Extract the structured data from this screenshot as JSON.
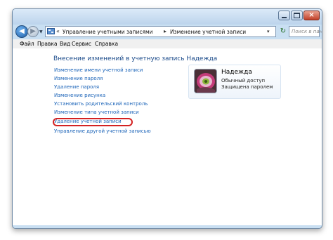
{
  "window": {
    "caption": {
      "minimize": "minimize",
      "maximize": "maximize",
      "close": "×"
    }
  },
  "nav": {
    "back_glyph": "◀",
    "forward_glyph": "▶",
    "history_glyph": "▼",
    "breadcrumb": [
      "Управление учетными записями",
      "Изменение учетной записи"
    ],
    "separator": "▸",
    "overflow": "«",
    "drop_glyph": "▾",
    "refresh_glyph": "↻",
    "search_placeholder": "Поиск в пане..."
  },
  "menu": [
    "Файл",
    "Правка",
    "Вид",
    "Сервис",
    "Справка"
  ],
  "content": {
    "heading": "Внесение изменений в учетную запись Надежда",
    "tasks": [
      "Изменение имени учетной записи",
      "Изменение пароля",
      "Удаление пароля",
      "Изменение рисунка",
      "Установить родительский контроль",
      "Изменение типа учетной записи",
      "Удаление учетной записи",
      "Управление другой учетной записью"
    ],
    "highlighted_task": "Удаление учетной записи"
  },
  "user": {
    "name": "Надежда",
    "account_type": "Обычный доступ",
    "protection": "Защищена паролем",
    "avatar": "flower-avatar"
  },
  "colors": {
    "link": "#1a63b8",
    "heading": "#1a4a8a",
    "highlight": "#d42222",
    "chrome": "#c9dff2"
  }
}
